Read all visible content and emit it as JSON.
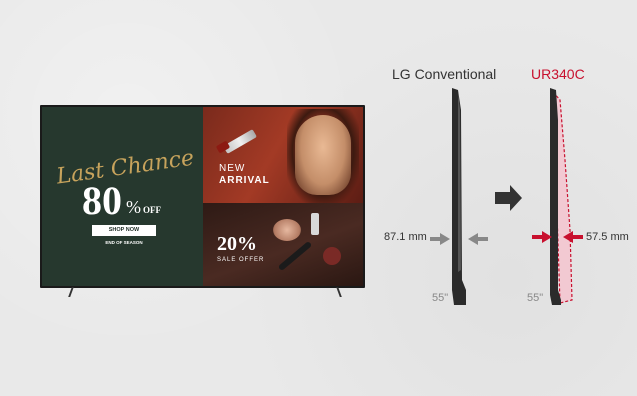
{
  "promo": {
    "headline": "Last Chance",
    "discount_number": "80",
    "discount_percent": "%",
    "discount_suffix": "OFF",
    "shop_button": "SHOP NOW",
    "season_text": "END OF SEASON",
    "new_arrival_line1": "NEW",
    "new_arrival_line2": "ARRIVAL",
    "sale_percent": "20%",
    "sale_text": "SALE OFFER"
  },
  "comparison": {
    "conventional_label": "LG Conventional",
    "product_label": "UR340C",
    "conventional_size": "55\"",
    "product_size": "55\"",
    "conventional_depth": "87.1 mm",
    "product_depth": "57.5 mm"
  },
  "colors": {
    "accent_red": "#c8102e",
    "arrow_grey": "#888888",
    "arrow_dark": "#333333"
  }
}
